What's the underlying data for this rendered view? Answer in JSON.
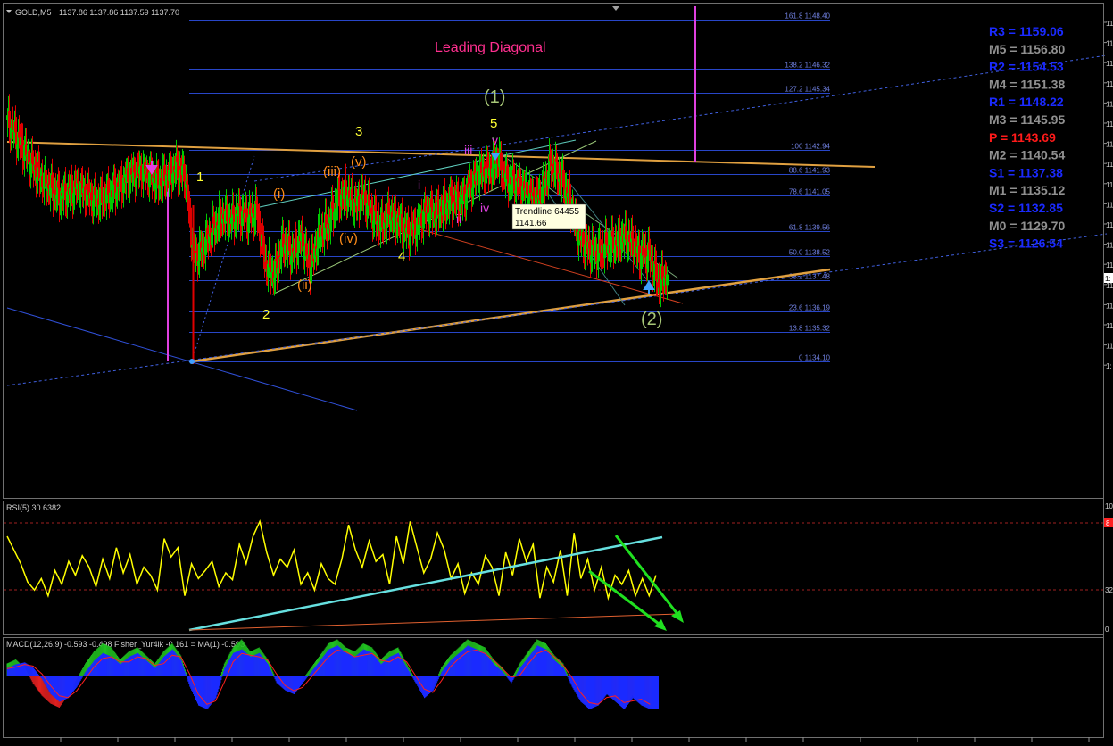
{
  "header": {
    "symbol": "GOLD,M5",
    "ohlc": "1137.86 1137.86 1137.59 1137.70"
  },
  "colors": {
    "background": "#000000",
    "bull": "#00c800",
    "bear": "#e00000",
    "fib": "#2846c8",
    "wave_white_yellow": "#ffff33",
    "wave_orange": "#ff8c1a",
    "wave_magenta": "#e040e0",
    "wave_green": "#a8c878",
    "title": "#ff2f8f",
    "rsi": "#ffff00",
    "trend_cyan": "#66e0e0",
    "trend_orange": "#e0a040"
  },
  "chart_data": [
    {
      "type": "line",
      "name": "price",
      "title": "Leading Diagonal",
      "x_index": [
        0,
        10,
        20,
        30,
        40,
        50,
        60,
        70,
        80,
        90,
        100,
        110,
        120,
        130,
        140,
        150,
        160,
        170,
        180,
        190,
        200,
        210,
        220,
        230,
        240,
        250,
        260,
        270,
        280,
        290,
        300,
        310,
        320,
        330,
        340,
        350,
        360,
        370,
        380,
        390,
        400,
        410,
        420,
        430,
        440,
        450,
        460,
        470,
        480,
        490,
        500,
        510,
        520,
        530,
        540,
        550,
        560,
        570,
        580,
        590,
        600,
        610,
        620,
        630,
        640,
        650,
        660,
        670,
        680,
        690,
        700,
        710,
        720,
        730,
        740
      ],
      "close": [
        1144.2,
        1143.6,
        1142.9,
        1142.2,
        1141.7,
        1141.3,
        1141.0,
        1141.2,
        1141.4,
        1141.1,
        1140.8,
        1141.0,
        1141.3,
        1141.6,
        1141.9,
        1142.1,
        1141.9,
        1141.6,
        1141.9,
        1142.2,
        1141.9,
        1138.4,
        1138.9,
        1139.5,
        1140.2,
        1140.0,
        1140.3,
        1140.1,
        1140.4,
        1138.2,
        1137.7,
        1139.1,
        1138.6,
        1139.3,
        1138.0,
        1139.4,
        1139.8,
        1140.8,
        1141.2,
        1140.6,
        1141.0,
        1140.2,
        1139.8,
        1140.3,
        1139.9,
        1139.5,
        1139.8,
        1140.4,
        1140.3,
        1140.6,
        1140.9,
        1140.8,
        1141.5,
        1142.0,
        1142.1,
        1142.6,
        1141.7,
        1141.6,
        1141.3,
        1140.9,
        1141.2,
        1142.4,
        1141.8,
        1141.0,
        1139.4,
        1138.9,
        1138.6,
        1138.9,
        1139.0,
        1139.3,
        1139.1,
        1138.5,
        1138.6,
        1137.4,
        1137.7
      ],
      "annotations": {
        "tooltip_title": "Trendline 64455",
        "tooltip_value": "1141.66",
        "right_label": "1:"
      },
      "fib_levels": [
        {
          "label": "161.8 1148.40",
          "price": 1148.4
        },
        {
          "label": "138.2 1146.32",
          "price": 1146.32
        },
        {
          "label": "127.2 1145.34",
          "price": 1145.34
        },
        {
          "label": "100 1142.94",
          "price": 1142.94
        },
        {
          "label": "88.6 1141.93",
          "price": 1141.93
        },
        {
          "label": "78.6 1141.05",
          "price": 1141.05
        },
        {
          "label": "61.8 1139.56",
          "price": 1139.56
        },
        {
          "label": "50.0 1138.52",
          "price": 1138.52
        },
        {
          "label": "38.2 1137.48",
          "price": 1137.48
        },
        {
          "label": "23.6 1136.19",
          "price": 1136.19
        },
        {
          "label": "13.8 1135.32",
          "price": 1135.32
        },
        {
          "label": "0 1134.10",
          "price": 1134.1
        }
      ],
      "wave_labels": {
        "primary": [
          "1",
          "2",
          "3",
          "4",
          "5"
        ],
        "minor": [
          "(i)",
          "(ii)",
          "(iii)",
          "(iv)",
          "(v)"
        ],
        "minute": [
          "i",
          "ii",
          "iii",
          "iv",
          "v"
        ],
        "intermediate": [
          "(1)",
          "(2)"
        ]
      },
      "y_axis_ticks": [
        "11",
        "11",
        "11",
        "11",
        "11",
        "11",
        "11",
        "11",
        "11",
        "11",
        "11",
        "11",
        "11",
        "11",
        "11",
        "11",
        "11",
        "1:"
      ]
    },
    {
      "type": "table",
      "name": "pivots",
      "rows": [
        {
          "label": "R3",
          "value": "1159.06",
          "color": "#1a2aff"
        },
        {
          "label": "M5",
          "value": "1156.80",
          "color": "#909090"
        },
        {
          "label": "R2",
          "value": "1154.53",
          "color": "#1a2aff"
        },
        {
          "label": "M4",
          "value": "1151.38",
          "color": "#909090"
        },
        {
          "label": "R1",
          "value": "1148.22",
          "color": "#1a2aff"
        },
        {
          "label": "M3",
          "value": "1145.95",
          "color": "#909090"
        },
        {
          "label": "P ",
          "value": "1143.69",
          "color": "#ff1a1a"
        },
        {
          "label": "M2",
          "value": "1140.54",
          "color": "#909090"
        },
        {
          "label": "S1",
          "value": "1137.38",
          "color": "#1a2aff"
        },
        {
          "label": "M1",
          "value": "1135.12",
          "color": "#909090"
        },
        {
          "label": "S2",
          "value": "1132.85",
          "color": "#1a2aff"
        },
        {
          "label": "M0",
          "value": "1129.70",
          "color": "#909090"
        },
        {
          "label": "S3",
          "value": "1126.54",
          "color": "#1a2aff"
        }
      ]
    },
    {
      "type": "line",
      "name": "rsi",
      "title": "RSI(5) 30.6382",
      "ylim": [
        0,
        100
      ],
      "y_ticks": [
        "10",
        "32",
        "0"
      ],
      "marker": "8",
      "values": [
        82,
        70,
        58,
        42,
        35,
        45,
        30,
        52,
        40,
        60,
        48,
        65,
        55,
        38,
        62,
        45,
        72,
        50,
        66,
        40,
        55,
        48,
        35,
        80,
        64,
        72,
        30,
        58,
        45,
        52,
        60,
        38,
        50,
        44,
        75,
        58,
        82,
        95,
        68,
        48,
        62,
        55,
        70,
        40,
        50,
        35,
        58,
        45,
        40,
        62,
        92,
        70,
        55,
        78,
        60,
        66,
        40,
        82,
        58,
        95,
        72,
        50,
        62,
        85,
        70,
        45,
        58,
        32,
        50,
        40,
        65,
        55,
        30,
        68,
        48,
        80,
        60,
        75,
        28,
        55,
        42,
        70,
        30,
        85,
        45,
        62,
        35,
        55,
        28,
        48,
        40,
        52,
        30,
        45,
        30,
        48
      ],
      "ymax_line": 90,
      "ymid_line": 32
    },
    {
      "type": "bar",
      "name": "macd",
      "title": "MACD(12,26,9) -0.593 -0.498  Fisher_Yur4ik -0.161  = MA(1) -0.593",
      "fisher": [
        0.2,
        0.3,
        0.35,
        0.2,
        -0.1,
        -0.5,
        -0.7,
        -0.6,
        -0.3,
        0.1,
        0.4,
        0.6,
        0.5,
        0.3,
        0.5,
        0.6,
        0.4,
        0.2,
        0.5,
        0.7,
        0.4,
        -0.3,
        -0.8,
        -0.9,
        -0.6,
        0.2,
        0.6,
        0.7,
        0.5,
        0.6,
        0.3,
        -0.2,
        -0.4,
        -0.5,
        -0.2,
        0.1,
        0.4,
        0.7,
        0.8,
        0.6,
        0.5,
        0.7,
        0.6,
        0.3,
        0.5,
        0.6,
        0.2,
        -0.2,
        -0.6,
        -0.4,
        0.1,
        0.4,
        0.6,
        0.8,
        0.7,
        0.6,
        0.3,
        0.1,
        -0.2,
        0.2,
        0.5,
        0.8,
        0.7,
        0.4,
        0.2,
        -0.3,
        -0.7,
        -0.9,
        -0.8,
        -0.5,
        -0.7,
        -0.9,
        -0.6,
        -0.8,
        -0.9
      ],
      "macd_hist": [
        0.3,
        0.4,
        0.2,
        -0.2,
        -0.5,
        -0.7,
        -0.8,
        -0.5,
        -0.1,
        0.3,
        0.6,
        0.8,
        0.7,
        0.4,
        0.6,
        0.7,
        0.5,
        0.3,
        0.6,
        0.8,
        0.5,
        -0.2,
        -0.6,
        -0.8,
        -0.4,
        0.3,
        0.7,
        0.9,
        0.6,
        0.7,
        0.4,
        -0.1,
        -0.3,
        -0.4,
        -0.1,
        0.2,
        0.5,
        0.8,
        0.9,
        0.7,
        0.6,
        0.8,
        0.7,
        0.4,
        0.6,
        0.7,
        0.3,
        -0.1,
        -0.5,
        -0.3,
        0.2,
        0.5,
        0.7,
        0.9,
        0.8,
        0.7,
        0.4,
        0.2,
        -0.1,
        0.3,
        0.6,
        0.9,
        0.8,
        0.5,
        0.3,
        -0.2,
        -0.6,
        -0.8,
        -0.7,
        -0.4,
        -0.6,
        -0.8,
        -0.5,
        -0.7,
        -0.8
      ]
    }
  ],
  "labels": {
    "title_text": "Leading Diagonal",
    "w1": "1",
    "w2": "2",
    "w3": "3",
    "w4": "4",
    "w5": "5",
    "m1": "(i)",
    "m2": "(ii)",
    "m3": "(iii)",
    "m4": "(iv)",
    "m5": "(v)",
    "n1": "i",
    "n2": "ii",
    "n3": "iii",
    "n4": "iv",
    "n5": "v",
    "big1": "(1)",
    "big2": "(2)"
  }
}
